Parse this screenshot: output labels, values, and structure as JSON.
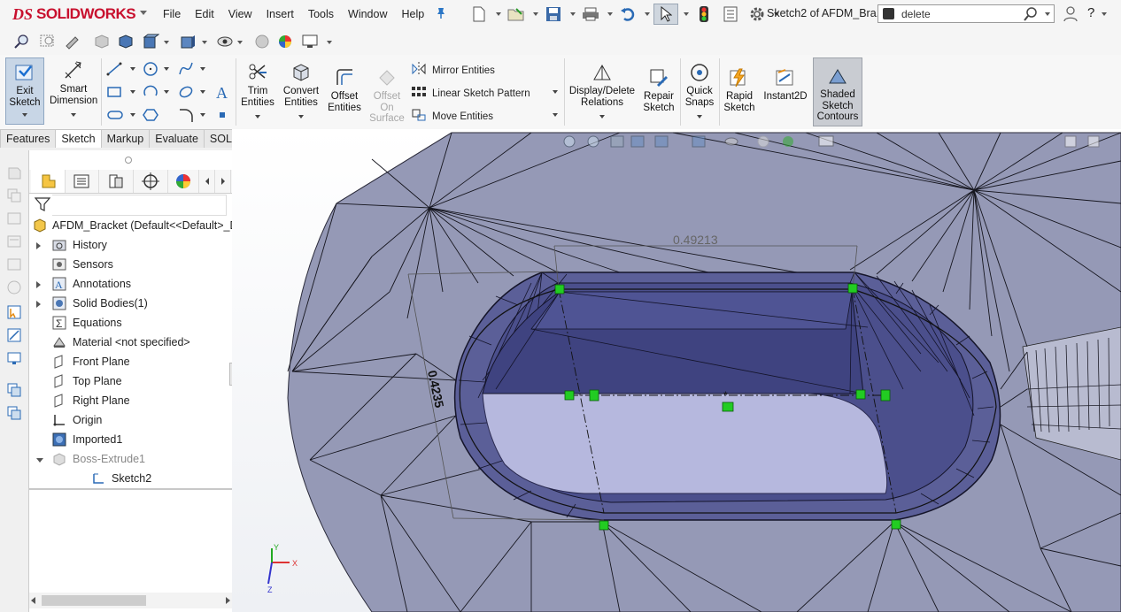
{
  "app": {
    "logo_ds": "DS",
    "logo_name": "SOLIDWORKS",
    "document_title": "Sketch2 of AFDM_Bra..."
  },
  "menu": [
    "File",
    "Edit",
    "View",
    "Insert",
    "Tools",
    "Window",
    "Help"
  ],
  "search": {
    "value": "delete"
  },
  "help_label": "?",
  "ribbon": {
    "exit_sketch": [
      "Exit",
      "Sketch"
    ],
    "smart_dimension": [
      "Smart",
      "Dimension"
    ],
    "trim_entities": [
      "Trim",
      "Entities"
    ],
    "convert_entities": [
      "Convert",
      "Entities"
    ],
    "offset_entities": [
      "Offset",
      "Entities"
    ],
    "offset_on_surface": [
      "Offset",
      "On",
      "Surface"
    ],
    "mirror_entities": "Mirror Entities",
    "linear_sketch_pattern": "Linear Sketch Pattern",
    "move_entities": "Move Entities",
    "display_delete_relations": [
      "Display/Delete",
      "Relations"
    ],
    "repair_sketch": [
      "Repair",
      "Sketch"
    ],
    "quick_snaps": [
      "Quick",
      "Snaps"
    ],
    "rapid_sketch": [
      "Rapid",
      "Sketch"
    ],
    "instant2d": "Instant2D",
    "shaded_sketch_contours": [
      "Shaded",
      "Sketch",
      "Contours"
    ]
  },
  "tabs": [
    "Features",
    "Sketch",
    "Markup",
    "Evaluate",
    "SOLIDWORKS Add-Ins"
  ],
  "active_tab": "Sketch",
  "tree": {
    "root": "AFDM_Bracket  (Default<<Default>_D",
    "items": [
      {
        "label": "History",
        "icon": "history-folder-icon",
        "expandable": true
      },
      {
        "label": "Sensors",
        "icon": "sensors-icon",
        "expandable": false
      },
      {
        "label": "Annotations",
        "icon": "annotations-icon",
        "expandable": true
      },
      {
        "label": "Solid Bodies(1)",
        "icon": "solid-bodies-icon",
        "expandable": true
      },
      {
        "label": "Equations",
        "icon": "equations-icon",
        "expandable": false
      },
      {
        "label": "Material <not specified>",
        "icon": "material-icon",
        "expandable": false
      },
      {
        "label": "Front Plane",
        "icon": "plane-icon",
        "expandable": false
      },
      {
        "label": "Top Plane",
        "icon": "plane-icon",
        "expandable": false
      },
      {
        "label": "Right Plane",
        "icon": "plane-icon",
        "expandable": false
      },
      {
        "label": "Origin",
        "icon": "origin-icon",
        "expandable": false
      },
      {
        "label": "Imported1",
        "icon": "imported-body-icon",
        "expandable": false
      },
      {
        "label": "Boss-Extrude1",
        "icon": "boss-extrude-icon",
        "expandable": true,
        "expanded": true
      },
      {
        "label": "Sketch2",
        "icon": "sketch-icon",
        "expandable": false,
        "child": true
      }
    ]
  },
  "viewport": {
    "dim_horizontal": "0.49213",
    "dim_vertical": "0.4235",
    "triad": {
      "x": "X",
      "y": "Y",
      "z": "Z"
    }
  },
  "colors": {
    "accent": "#2a76c6",
    "brand": "#c8102e",
    "model_face": "#9598b4",
    "slot_face": "#4a4f8a",
    "sketch_point": "#22cc22"
  }
}
